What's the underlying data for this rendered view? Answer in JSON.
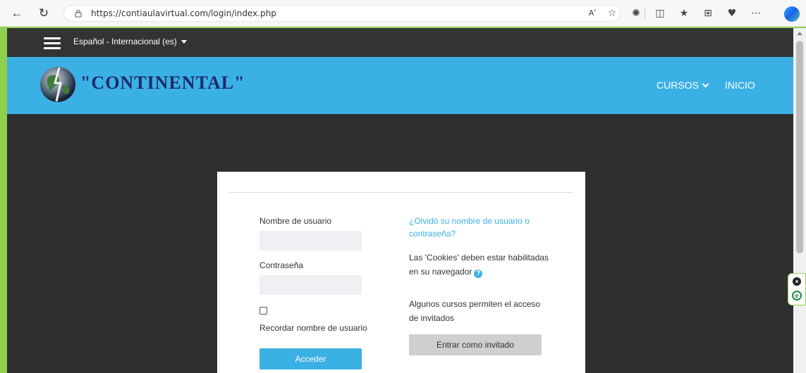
{
  "browser": {
    "url": "https://contiaulavirtual.com/login/index.php",
    "read_aloud_label": "Aʹ"
  },
  "site": {
    "language": "Español - Internacional (es)",
    "logo_text": "\"CONTINENTAL\"",
    "nav": {
      "courses": "CURSOS",
      "home": "INICIO"
    }
  },
  "login": {
    "username_label": "Nombre de usuario",
    "username_value": "",
    "password_label": "Contraseña",
    "password_value": "",
    "remember_label": "Recordar nombre de usuario",
    "submit_label": "Acceder",
    "forgot_link": "¿Olvidó su nombre de usuario o contraseña?",
    "cookies_notice": "Las 'Cookies' deben estar habilitadas en su navegador",
    "guest_notice": "Algunos cursos permiten el acceso de invitados",
    "guest_button": "Entrar como invitado"
  },
  "colors": {
    "accent": "#3bb0e4",
    "topbar": "#333333",
    "background": "#2f2f2f",
    "logo_text": "#1a2a6c"
  }
}
